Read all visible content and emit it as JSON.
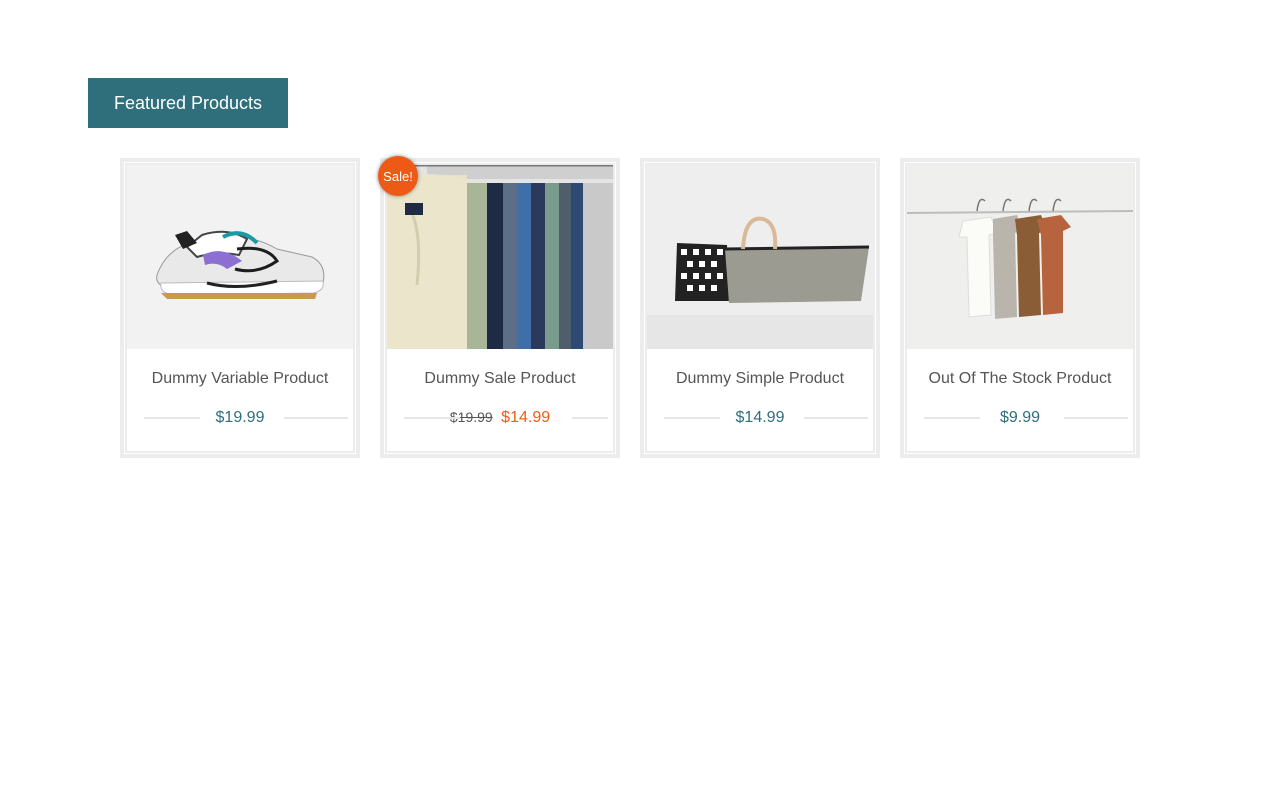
{
  "section": {
    "heading": "Featured Products"
  },
  "colors": {
    "accent": "#2f6e7b",
    "sale": "#ee5a16"
  },
  "products": [
    {
      "title": "Dummy Variable Product",
      "price": "$19.99",
      "image_icon": "sneaker-photo"
    },
    {
      "title": "Dummy Sale Product",
      "old_price": "$19.99",
      "price": "$14.99",
      "badge": "Sale!",
      "image_icon": "jeans-rack-photo"
    },
    {
      "title": "Dummy Simple Product",
      "price": "$14.99",
      "image_icon": "tote-bag-photo"
    },
    {
      "title": "Out Of The Stock Product",
      "price": "$9.99",
      "image_icon": "tshirts-on-rail-photo"
    }
  ]
}
